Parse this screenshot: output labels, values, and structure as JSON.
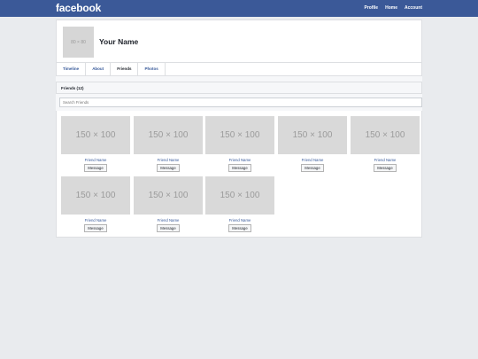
{
  "topbar": {
    "logo": "facebook",
    "nav": [
      "Profile",
      "Home",
      "Account"
    ]
  },
  "profile": {
    "avatar_placeholder": "80 × 80",
    "name": "Your Name"
  },
  "tabs": [
    {
      "label": "Timeline",
      "active": false
    },
    {
      "label": "About",
      "active": false
    },
    {
      "label": "Friends",
      "active": true
    },
    {
      "label": "Photos",
      "active": false
    }
  ],
  "friends": {
    "title": "Friends (12)",
    "search_placeholder": "Search Friends",
    "items": [
      {
        "thumb": "150 × 100",
        "name": "Friend Name",
        "button": "Message"
      },
      {
        "thumb": "150 × 100",
        "name": "Friend Name",
        "button": "Message"
      },
      {
        "thumb": "150 × 100",
        "name": "Friend Name",
        "button": "Message"
      },
      {
        "thumb": "150 × 100",
        "name": "Friend Name",
        "button": "Message"
      },
      {
        "thumb": "150 × 100",
        "name": "Friend Name",
        "button": "Message"
      },
      {
        "thumb": "150 × 100",
        "name": "Friend Name",
        "button": "Message"
      },
      {
        "thumb": "150 × 100",
        "name": "Friend Name",
        "button": "Message"
      },
      {
        "thumb": "150 × 100",
        "name": "Friend Name",
        "button": "Message"
      }
    ]
  }
}
